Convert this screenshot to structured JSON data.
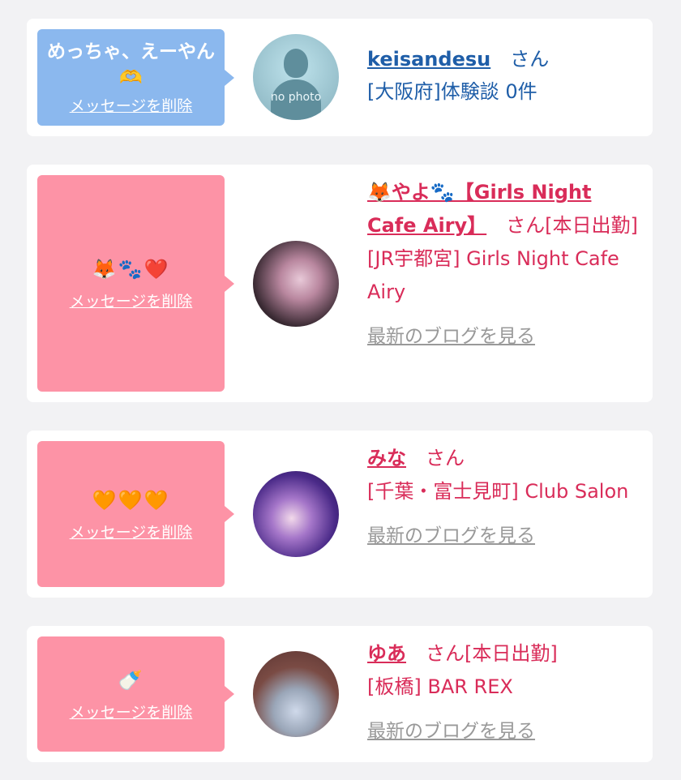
{
  "entries": [
    {
      "message": "めっちゃ、えーやん🫶",
      "delete_label": "メッセージを削除",
      "avatar_caption": "no photo",
      "name": "keisandesu",
      "honorific": "さん",
      "detail": "[大阪府]体験談 0件"
    },
    {
      "message": "🦊🐾❤️",
      "delete_label": "メッセージを削除",
      "name": "🦊やよ🐾【Girls Night Cafe Airy】",
      "honorific": "さん",
      "status": "[本日出勤]",
      "shop": "[JR宇都宮] Girls Night Cafe Airy",
      "blog_label": "最新のブログを見る"
    },
    {
      "message": "🧡🧡🧡",
      "delete_label": "メッセージを削除",
      "name": "みな",
      "honorific": "さん",
      "shop": "[千葉・富士見町] Club Salon",
      "blog_label": "最新のブログを見る"
    },
    {
      "message": "🍼",
      "delete_label": "メッセージを削除",
      "name": "ゆあ",
      "honorific": "さん",
      "status": "[本日出勤]",
      "shop": "[板橋] BAR REX",
      "blog_label": "最新のブログを見る"
    }
  ],
  "colors": {
    "bubble_blue": "#8bb8ee",
    "bubble_pink": "#fd93a6",
    "text_blue": "#1f5ea8",
    "text_pink": "#d92c59",
    "link_gray": "#999999"
  }
}
